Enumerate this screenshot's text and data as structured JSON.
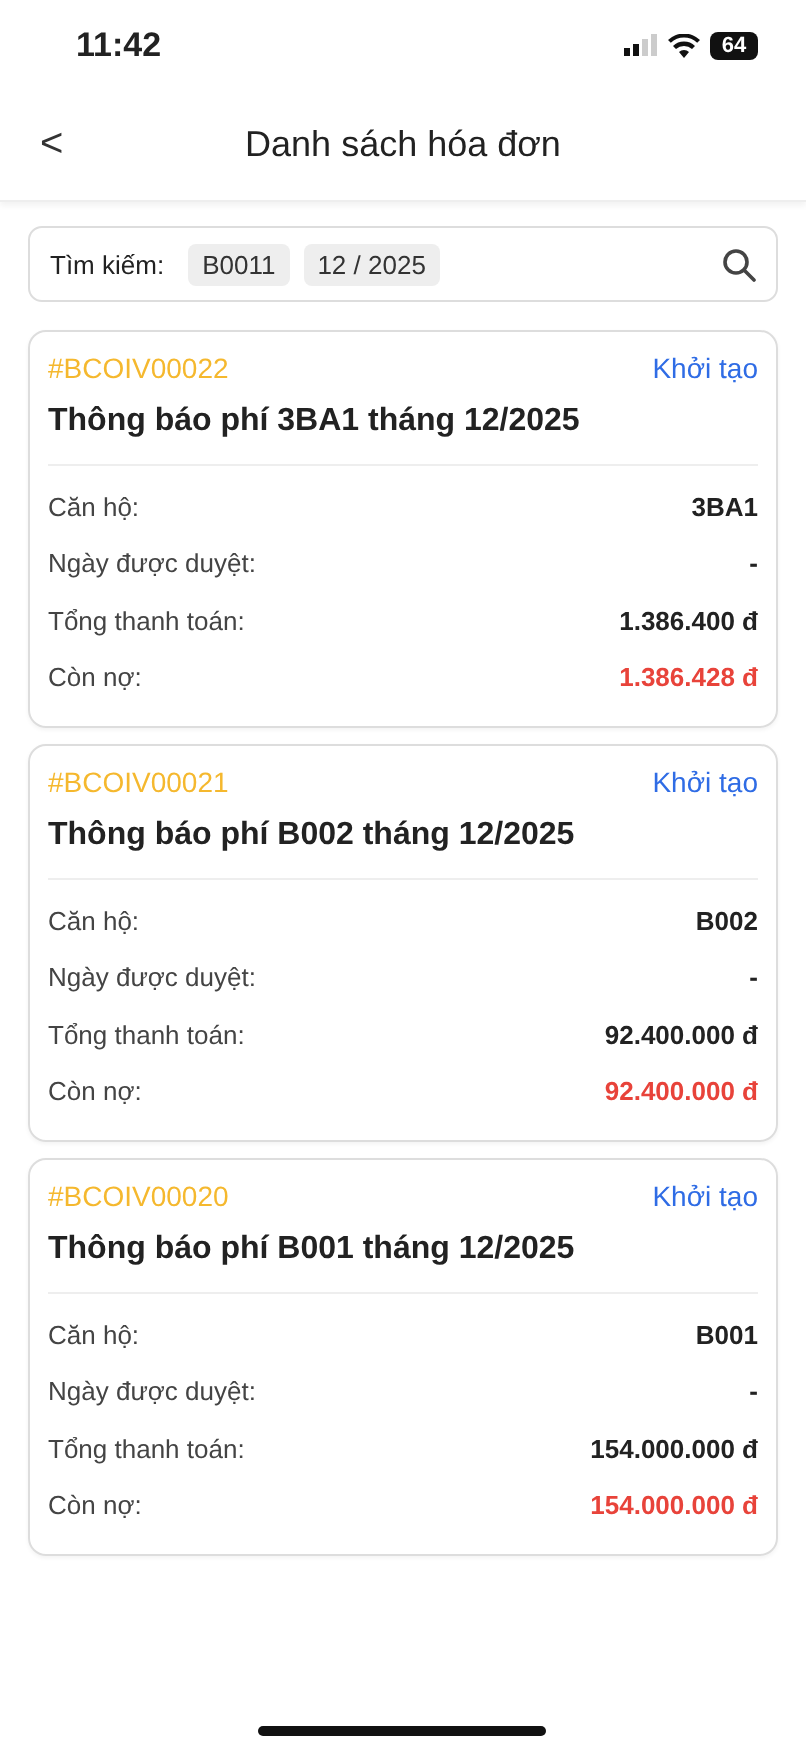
{
  "status_bar": {
    "time": "11:42",
    "battery": "64"
  },
  "header": {
    "back": "<",
    "title": "Danh sách hóa đơn"
  },
  "search": {
    "label": "Tìm kiếm:",
    "chips": [
      "B0011",
      "12 / 2025"
    ]
  },
  "invoices": [
    {
      "code": "#BCOIV00022",
      "status": "Khởi tạo",
      "title": "Thông báo phí 3BA1 tháng 12/2025",
      "rows": [
        {
          "label": "Căn hộ:",
          "value": "3BA1",
          "kind": "normal"
        },
        {
          "label": "Ngày được duyệt:",
          "value": "-",
          "kind": "normal"
        },
        {
          "label": "Tổng thanh toán:",
          "value": "1.386.400 đ",
          "kind": "normal"
        },
        {
          "label": "Còn nợ:",
          "value": "1.386.428 đ",
          "kind": "debt"
        }
      ]
    },
    {
      "code": "#BCOIV00021",
      "status": "Khởi tạo",
      "title": "Thông báo phí B002 tháng 12/2025",
      "rows": [
        {
          "label": "Căn hộ:",
          "value": "B002",
          "kind": "normal"
        },
        {
          "label": "Ngày được duyệt:",
          "value": "-",
          "kind": "normal"
        },
        {
          "label": "Tổng thanh toán:",
          "value": "92.400.000 đ",
          "kind": "normal"
        },
        {
          "label": "Còn nợ:",
          "value": "92.400.000 đ",
          "kind": "debt"
        }
      ]
    },
    {
      "code": "#BCOIV00020",
      "status": "Khởi tạo",
      "title": "Thông báo phí B001 tháng 12/2025",
      "rows": [
        {
          "label": "Căn hộ:",
          "value": "B001",
          "kind": "normal"
        },
        {
          "label": "Ngày được duyệt:",
          "value": "-",
          "kind": "normal"
        },
        {
          "label": "Tổng thanh toán:",
          "value": "154.000.000 đ",
          "kind": "normal"
        },
        {
          "label": "Còn nợ:",
          "value": "154.000.000 đ",
          "kind": "debt"
        }
      ]
    }
  ]
}
